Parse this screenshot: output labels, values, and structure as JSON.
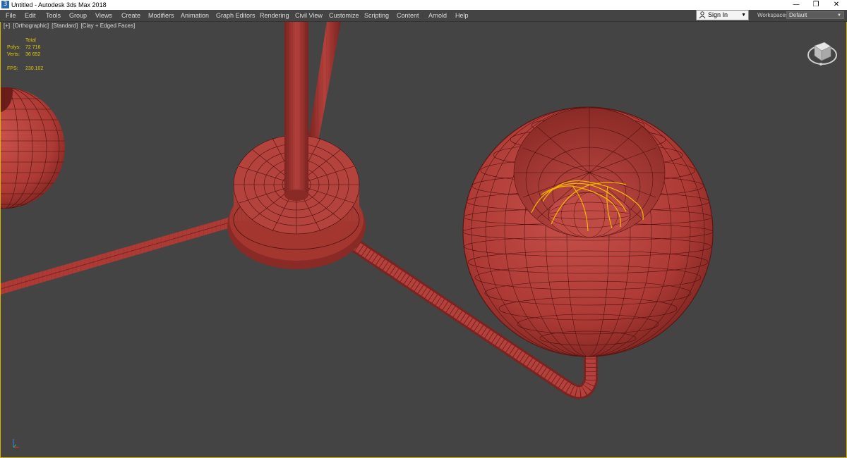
{
  "window": {
    "title": "Untitled - Autodesk 3ds Max 2018",
    "app_icon_glyph": "3",
    "controls": {
      "minimize": "—",
      "maximize": "❐",
      "close": "✕"
    }
  },
  "menu": {
    "items": [
      "File",
      "Edit",
      "Tools",
      "Group",
      "Views",
      "Create",
      "Modifiers",
      "Animation",
      "Graph Editors",
      "Rendering",
      "Civil View",
      "Customize",
      "Scripting",
      "Content",
      "Arnold",
      "Help"
    ]
  },
  "signin": {
    "label": "Sign In",
    "caret": "▼"
  },
  "workspaces": {
    "label": "Workspaces:",
    "value": "Default",
    "caret": "▼"
  },
  "viewport": {
    "labels": {
      "plus": "[+]",
      "view": "[Orthographic]",
      "shading": "[Standard]",
      "style": "[Clay + Edged Faces]"
    },
    "stats": {
      "total_label": "Total",
      "polys_label": "Polys:",
      "polys_value": "72 716",
      "verts_label": "Verts:",
      "verts_value": "36 652",
      "fps_label": "FPS:",
      "fps_value": "230.102"
    }
  },
  "colors": {
    "ui_bg": "#444444",
    "viewport_bg": "#444444",
    "model_red": "#b23a36",
    "wire": "#4a0f0d",
    "selection_yellow": "#f2b800",
    "stats_yellow": "#e1c800",
    "viewport_border": "#d9b400"
  }
}
